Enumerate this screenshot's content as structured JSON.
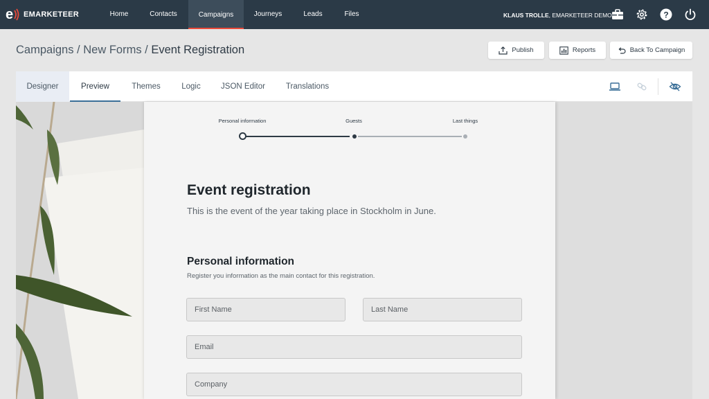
{
  "app": {
    "name": "EMARKETEER",
    "nav": [
      "Home",
      "Contacts",
      "Campaigns",
      "Journeys",
      "Leads",
      "Files"
    ],
    "user": {
      "name": "KLAUS TROLLE",
      "org": ", EMARKETEER DEMO"
    }
  },
  "breadcrumb": {
    "part1": "Campaigns",
    "sep": " / ",
    "part2": "New Forms",
    "current": "Event Registration"
  },
  "actions": {
    "publish": "Publish",
    "reports": "Reports",
    "back": "Back To Campaign"
  },
  "tabs": [
    "Designer",
    "Preview",
    "Themes",
    "Logic",
    "JSON Editor",
    "Translations"
  ],
  "active_tab": "Preview",
  "toolbar_icons": [
    "laptop-icon",
    "link-icon",
    "eye-off-icon"
  ],
  "topbar_icons": [
    "briefcase-icon",
    "gear-icon",
    "help-icon",
    "power-icon"
  ],
  "form": {
    "steps": [
      "Personal information",
      "Guests",
      "Last things"
    ],
    "title": "Event registration",
    "subtitle": "This is the event of the year taking place in Stockholm in June.",
    "section_title": "Personal information",
    "section_subtitle": "Register you information as the main contact for this registration.",
    "fields": {
      "first_name": "First Name",
      "last_name": "Last Name",
      "email": "Email",
      "company": "Company"
    }
  },
  "colors": {
    "navbar": "#2b3a47",
    "accent": "#e84a3a",
    "tab_underline": "#3b6f98",
    "leaf": "#4e6537"
  }
}
